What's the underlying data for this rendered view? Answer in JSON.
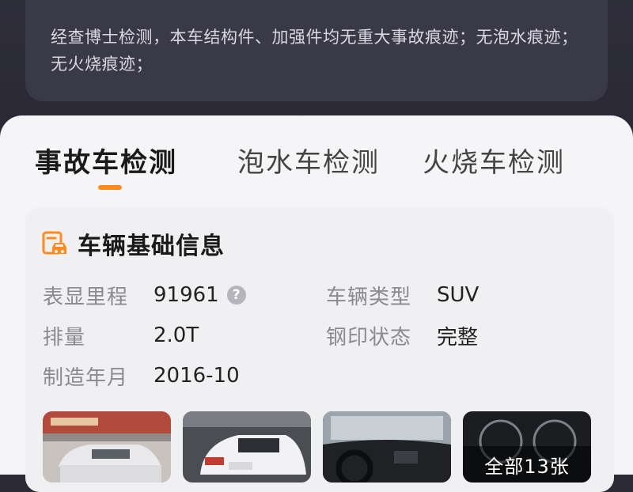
{
  "summary": {
    "text": "经查博士检测，本车结构件、加强件均无重大事故痕迹；无泡水痕迹；无火烧痕迹；"
  },
  "tabs": [
    {
      "label": "事故车检测",
      "active": true
    },
    {
      "label": "泡水车检测",
      "active": false
    },
    {
      "label": "火烧车检测",
      "active": false
    }
  ],
  "accent_color": "#ff8a1e",
  "basic_info": {
    "title": "车辆基础信息",
    "icon": "car-document-icon",
    "fields": [
      {
        "label": "表显里程",
        "value": "91961",
        "has_help": true
      },
      {
        "label": "车辆类型",
        "value": "SUV"
      },
      {
        "label": "排量",
        "value": "2.0T"
      },
      {
        "label": "钢印状态",
        "value": "完整"
      },
      {
        "label": "制造年月",
        "value": "2016-10"
      }
    ]
  },
  "photos": {
    "count_label": "全部13张"
  }
}
